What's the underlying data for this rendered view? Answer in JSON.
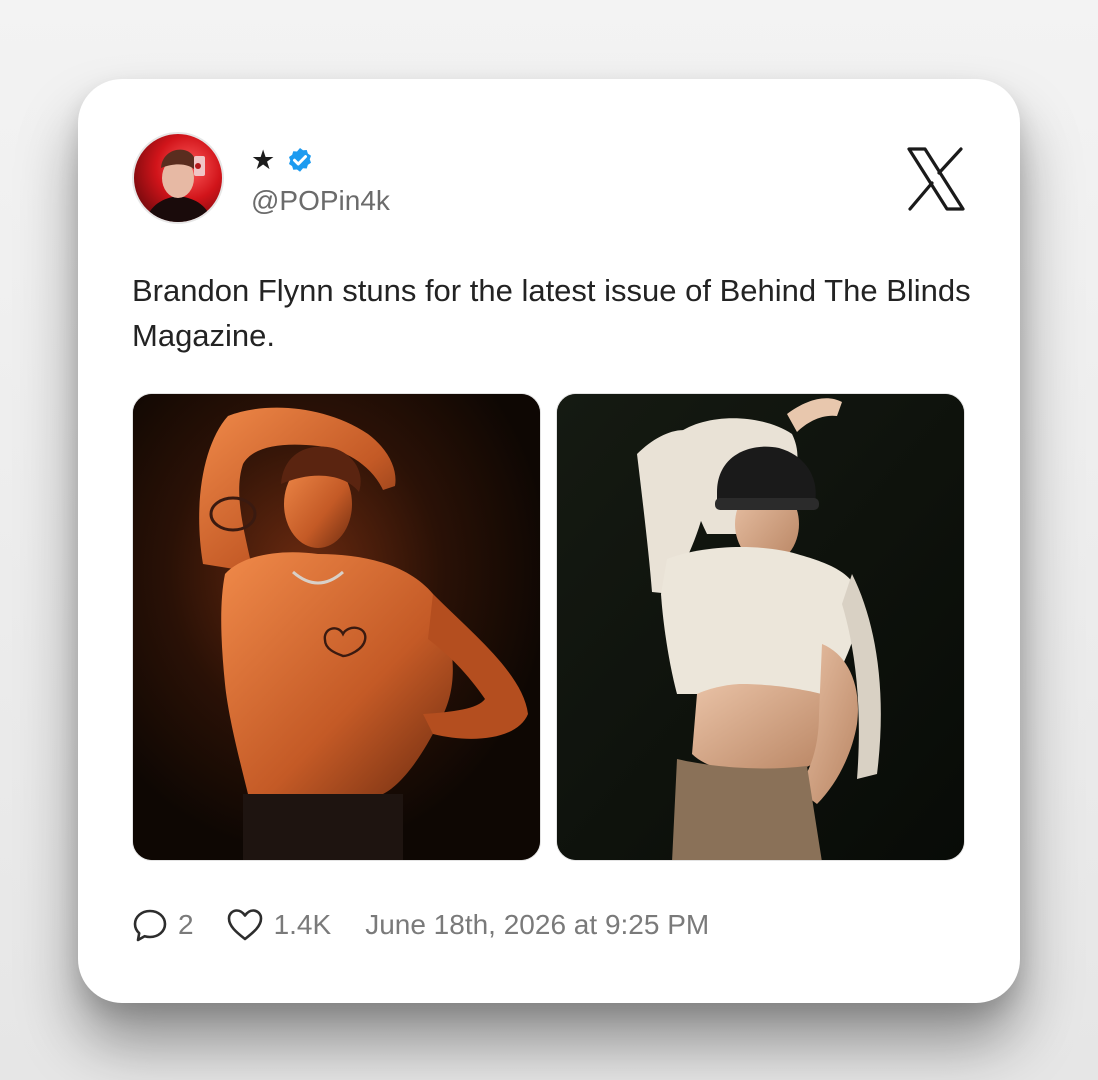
{
  "tweet": {
    "display_name": "★",
    "handle": "@POPin4k",
    "text": "Brandon Flynn stuns for the latest issue of Behind The Blinds Magazine.",
    "verified": true,
    "brand_icon": "x-logo-icon",
    "media": [
      {
        "icon": "photo-shirtless-man-orange-light"
      },
      {
        "icon": "photo-man-helmet-white-sweater"
      }
    ],
    "stats": {
      "reply_icon": "reply-icon",
      "replies": "2",
      "like_icon": "heart-icon",
      "likes": "1.4K",
      "timestamp": "June 18th, 2026 at 9:25 PM"
    }
  },
  "colors": {
    "verified_badge": "#1d9bf0",
    "avatar_accent": "#d1141a",
    "text_primary": "#232323",
    "text_secondary": "#6b6b6b"
  }
}
